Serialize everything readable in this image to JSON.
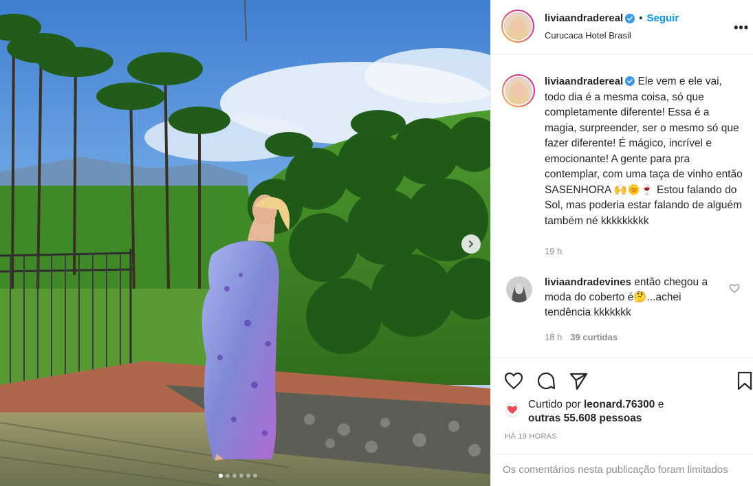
{
  "post": {
    "username": "liviaandradereal",
    "follow_label": "Seguir",
    "separator": "•",
    "location": "Curucaca Hotel Brasil",
    "more_label": "•••",
    "media": {
      "slide_count": 6,
      "active_slide": 1
    }
  },
  "caption": {
    "username": "liviaandradereal",
    "text": "Ele vem e ele vai, todo dia é a mesma coisa, só que completamente diferente! Essa é a magia, surpreender, ser o mesmo só que fazer diferente! É mágico, incrível e emocionante! A gente para pra contemplar, com uma taça de vinho então SASENHORA 🙌🌞🍷 Estou falando do Sol, mas poderia estar falando de alguém também né kkkkkkkkk",
    "time": "19 h"
  },
  "comment": {
    "username": "liviaandradevines",
    "text": "então chegou a moda do coberto é🤔...achei tendência kkkkkkk",
    "time": "18 h",
    "likes": "39 curtidas"
  },
  "likes": {
    "prefix": "Curtido por",
    "user": "leonard.76300",
    "connector": "e",
    "others": "outras 55.608 pessoas"
  },
  "timestamp": "HÁ 19 HORAS",
  "comments_limited": "Os comentários nesta publicação foram limitados",
  "colors": {
    "link_blue": "#0095f6",
    "verified_blue": "#3897f0",
    "text": "#262626",
    "muted": "#8e8e8e",
    "heart_red": "#ed4956"
  },
  "icons": [
    "chevron-right-icon",
    "verified-icon",
    "more-icon",
    "heart-icon",
    "comment-icon",
    "share-icon",
    "bookmark-icon"
  ]
}
